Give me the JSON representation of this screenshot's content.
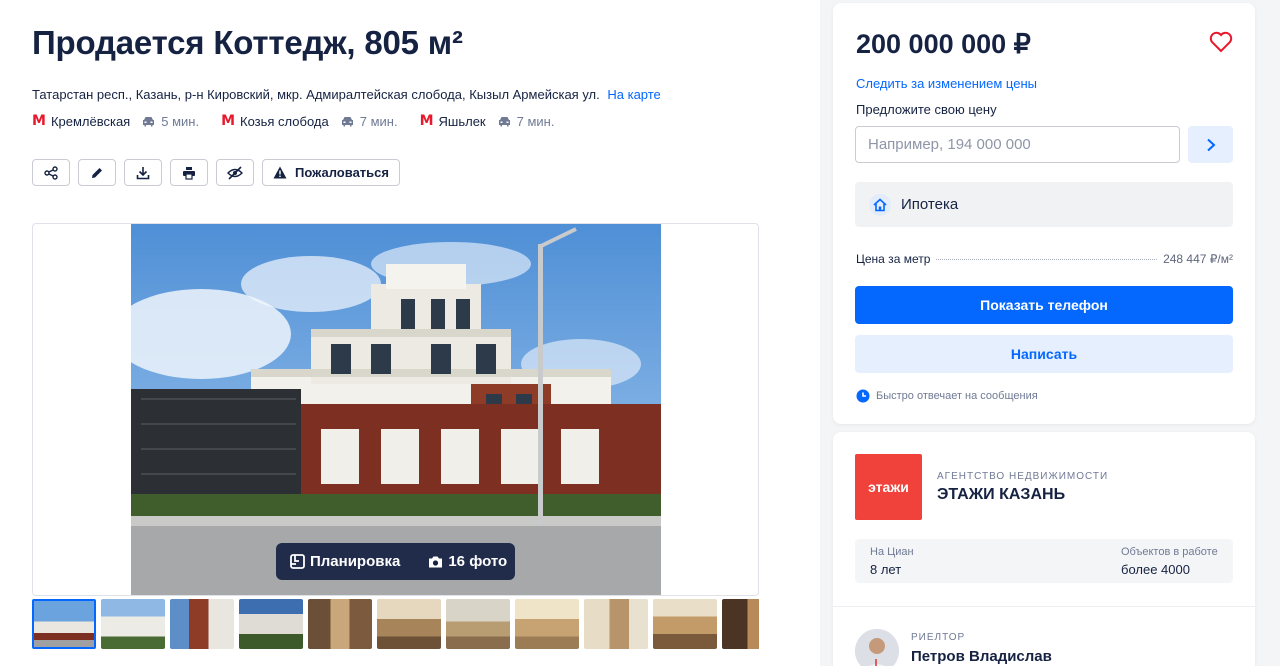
{
  "listing": {
    "title": "Продается Коттедж, 805 м²",
    "address": "Татарстан респ., Казань, р-н Кировский, мкр. Адмиралтейская слобода, Кызыл Армейская ул.",
    "map_link": "На карте",
    "metro": [
      {
        "name": "Кремлёвская",
        "time": "5 мин."
      },
      {
        "name": "Козья слобода",
        "time": "7 мин."
      },
      {
        "name": "Яшьлек",
        "time": "7 мин."
      }
    ],
    "tools": {
      "complain_label": "Пожаловаться"
    }
  },
  "gallery": {
    "plan_label": "Планировка",
    "photos_label": "16 фото",
    "thumbnail_count": 11
  },
  "price_card": {
    "price": "200 000 000 ₽",
    "follow_link": "Следить за изменением цены",
    "propose_label": "Предложите свою цену",
    "input_placeholder": "Например, 194 000 000",
    "mortgage_label": "Ипотека",
    "price_per_meter_label": "Цена за метр",
    "price_per_meter_value": "248 447 ₽/м²",
    "show_phone_label": "Показать телефон",
    "write_label": "Написать",
    "fast_reply_text": "Быстро отвечает на сообщения"
  },
  "agency": {
    "logo_text": "этажи",
    "type": "Агентство недвижимости",
    "name": "ЭТАЖИ КАЗАНЬ",
    "on_cian_label": "На Циан",
    "on_cian_value": "8 лет",
    "objects_label": "Объектов в работе",
    "objects_value": "более 4000"
  },
  "realtor": {
    "type": "Риелтор",
    "name": "Петров Владислав"
  },
  "colors": {
    "accent": "#0468ff",
    "metro": "#e8192c",
    "agency_logo": "#f0413a"
  }
}
